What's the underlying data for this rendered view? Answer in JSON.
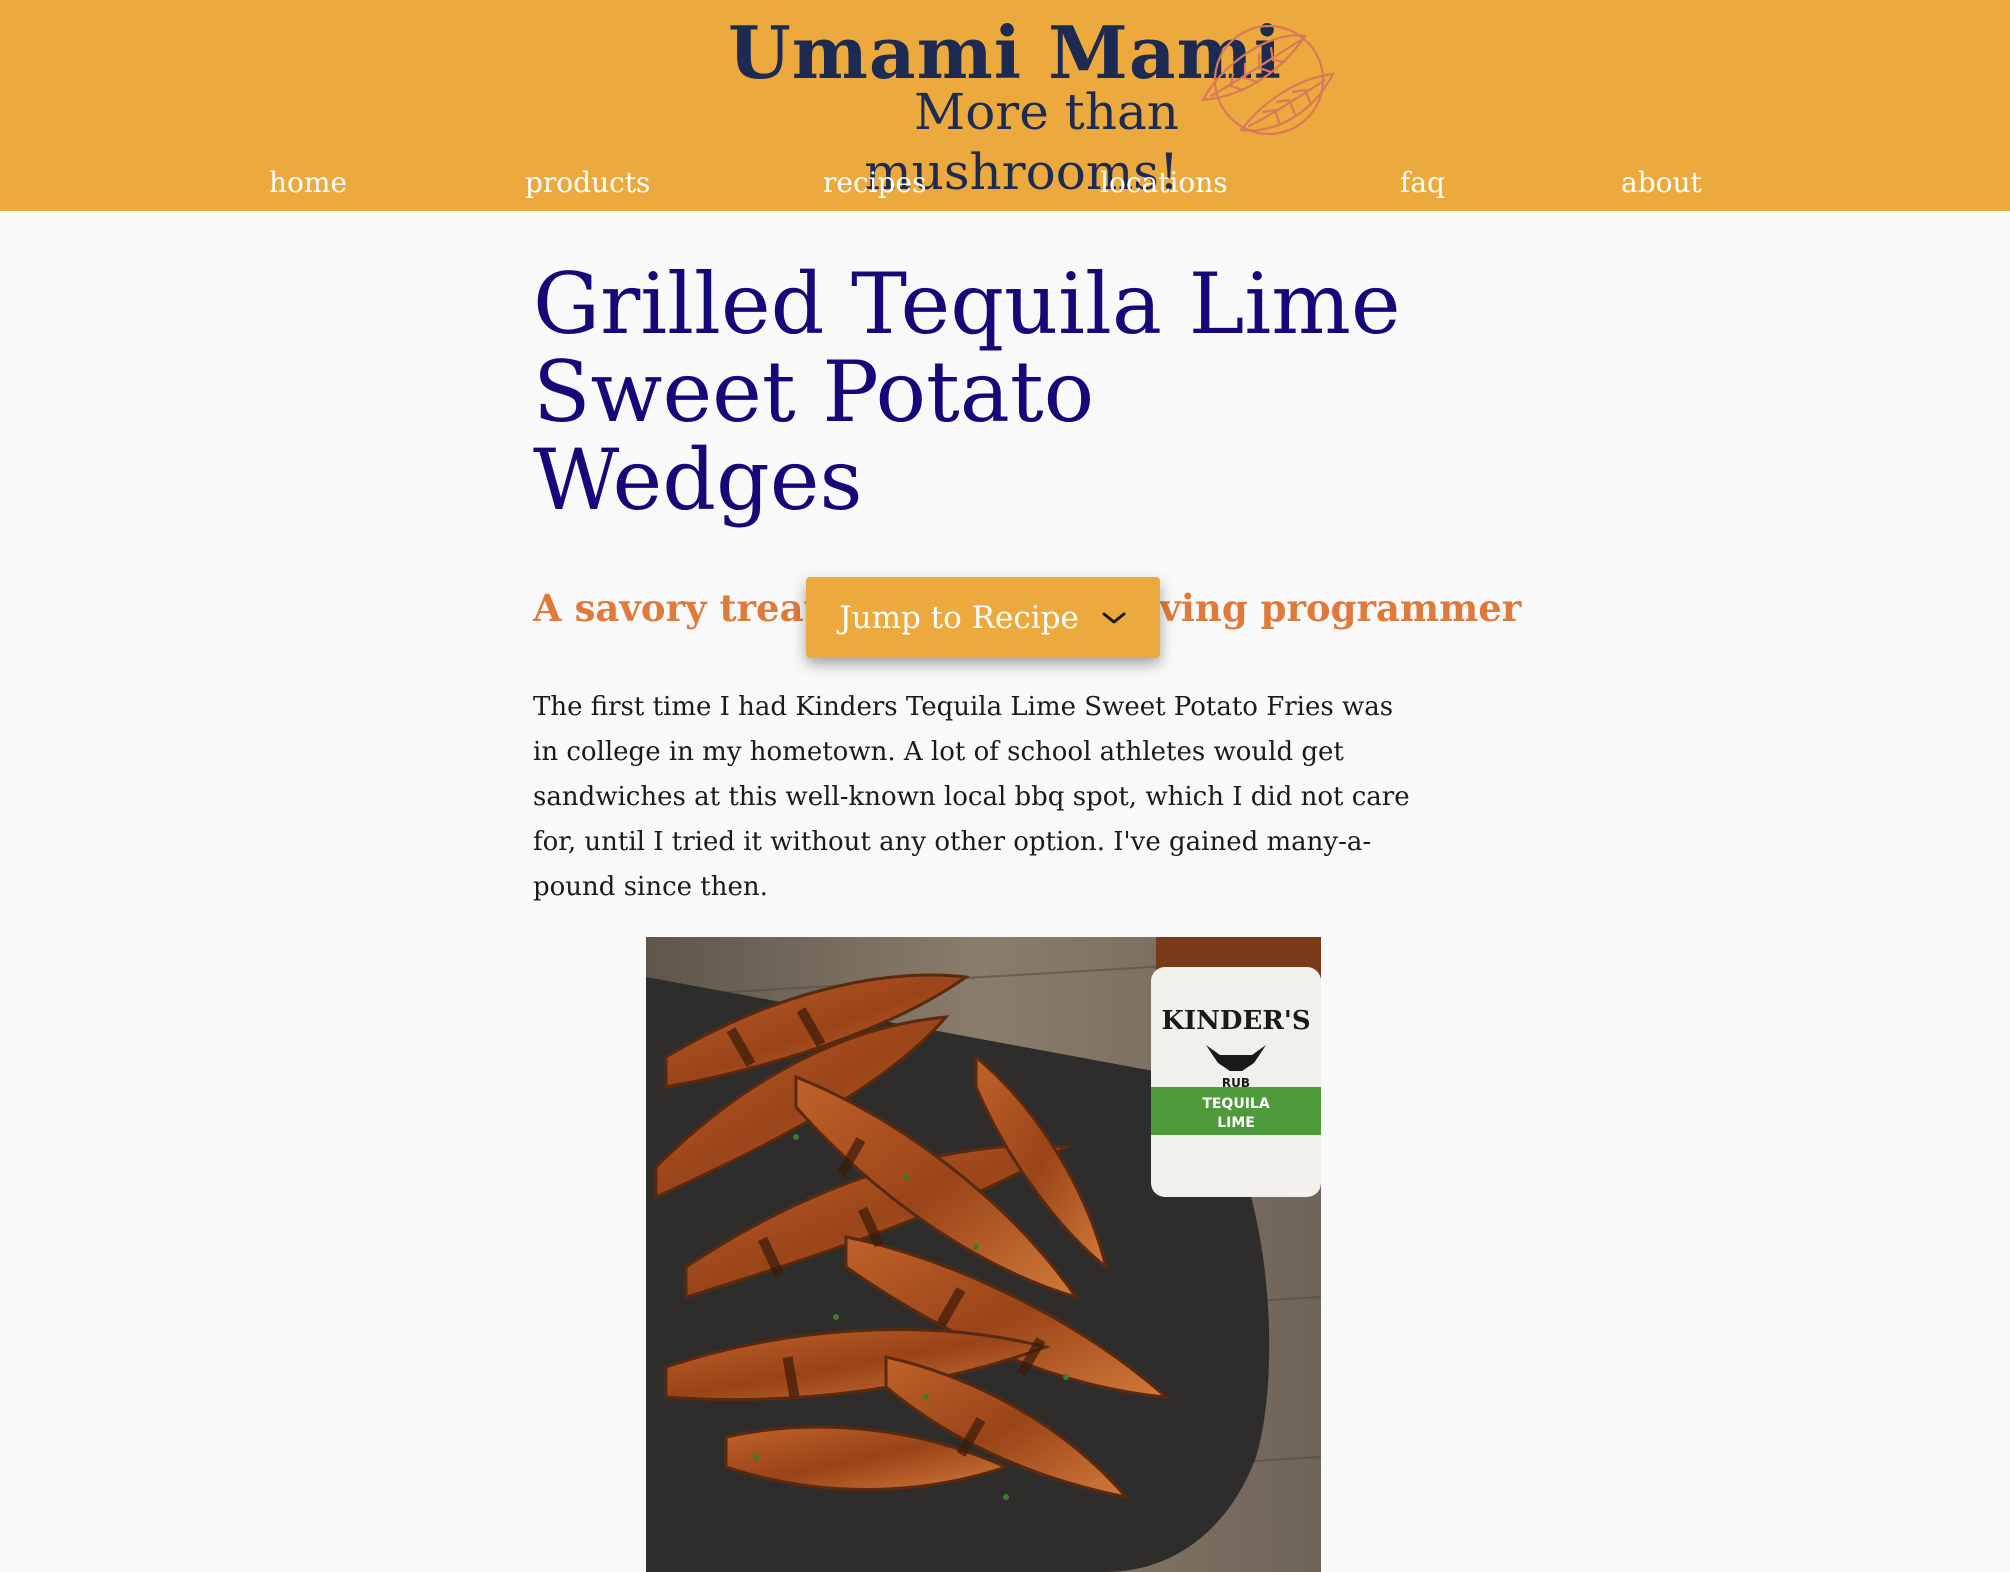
{
  "header": {
    "brand_title": "Umami Mami",
    "tagline": "More than mushrooms!",
    "logo_icon": "leaf-logo-icon",
    "background_color": "#ecaa3e"
  },
  "nav": {
    "items": [
      {
        "label": "home"
      },
      {
        "label": "products"
      },
      {
        "label": "recipes"
      },
      {
        "label": "locations"
      },
      {
        "label": "faq"
      },
      {
        "label": "about"
      }
    ]
  },
  "article": {
    "title": "Grilled Tequila Lime Sweet Potato Wedges",
    "subtitle": "A savory treat for the snack-loving programmer",
    "jump_button_label": "Jump to Recipe",
    "jump_button_icon": "chevron-down-icon",
    "intro": "The first time I had Kinders Tequila Lime Sweet Potato Fries was in college in my hometown. A lot of school athletes would get sandwiches at this well-known local bbq spot, which I did not care for, until I tried it without any other option. I've gained many-a-pound since then.",
    "photo": {
      "jar_brand": "KINDER'S",
      "jar_product": "RUB",
      "jar_flavor_line1": "TEQUILA",
      "jar_flavor_line2": "LIME"
    }
  },
  "colors": {
    "accent": "#ecaa3e",
    "title": "#15097a",
    "subtitle": "#de7b3a",
    "brand_text": "#1d2a52"
  }
}
